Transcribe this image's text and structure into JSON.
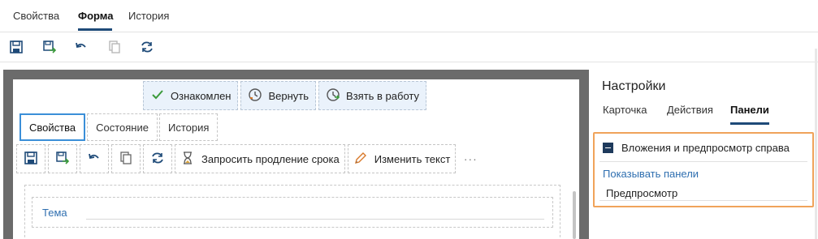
{
  "top_tabs": [
    {
      "label": "Свойства"
    },
    {
      "label": "Форма"
    },
    {
      "label": "История"
    }
  ],
  "toolbar": {
    "icons": [
      "save-icon",
      "save-and-exit-icon",
      "undo-icon",
      "copy-icon",
      "refresh-icon"
    ]
  },
  "preview": {
    "actions": [
      {
        "label": "Ознакомлен",
        "icon": "check-icon"
      },
      {
        "label": "Вернуть",
        "icon": "clock-back-icon"
      },
      {
        "label": "Взять в работу",
        "icon": "clock-play-icon"
      }
    ],
    "tabs": [
      {
        "label": "Свойства"
      },
      {
        "label": "Состояние"
      },
      {
        "label": "История"
      }
    ],
    "toolbar": {
      "request_extension": "Запросить продление срока",
      "edit_text": "Изменить текст",
      "more": "···"
    },
    "form": {
      "field_label": "Тема",
      "field_value": ""
    }
  },
  "settings": {
    "title": "Настройки",
    "tabs": [
      {
        "label": "Карточка"
      },
      {
        "label": "Действия"
      },
      {
        "label": "Панели"
      }
    ],
    "panel": {
      "header": "Вложения и предпросмотр справа",
      "link": "Показывать панели",
      "item": "Предпросмотр"
    }
  },
  "colors": {
    "accent": "#1e4a78",
    "link": "#2f6fb0",
    "highlight": "#f0a35a",
    "action_bg": "#eaf2fb",
    "active_tab_border": "#3b8fd8",
    "frame": "#6b6b6b"
  }
}
